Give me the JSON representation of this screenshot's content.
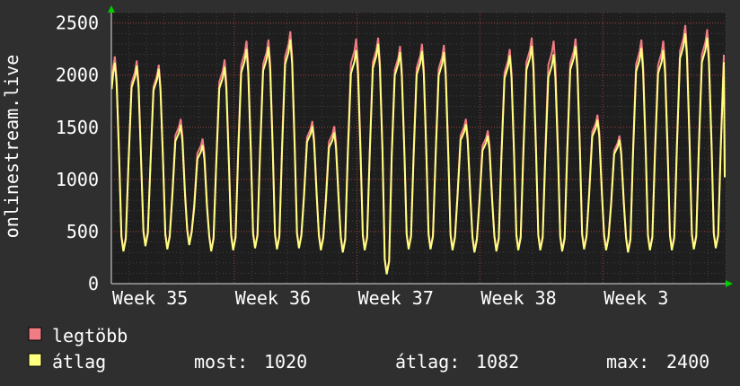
{
  "chart_data": {
    "type": "line",
    "ylabel": "onlinestream.live",
    "ylim": [
      0,
      2600
    ],
    "yticks": [
      0,
      500,
      1000,
      1500,
      2000,
      2500
    ],
    "xlim": [
      0,
      35
    ],
    "xticks": [
      {
        "label": "Week 35",
        "at": 0
      },
      {
        "label": "Week 36",
        "at": 7
      },
      {
        "label": "Week 37",
        "at": 14
      },
      {
        "label": "Week 38",
        "at": 21
      },
      {
        "label": "Week 3",
        "at": 28
      }
    ],
    "grid": true,
    "legend_position": "bottom-left",
    "daily_peaks": [
      {
        "max": 2180,
        "avg": 2120
      },
      {
        "max": 2140,
        "avg": 2090
      },
      {
        "max": 2100,
        "avg": 2060
      },
      {
        "max": 1580,
        "avg": 1520
      },
      {
        "max": 1390,
        "avg": 1330
      },
      {
        "max": 2150,
        "avg": 2080
      },
      {
        "max": 2330,
        "avg": 2250
      },
      {
        "max": 2340,
        "avg": 2270
      },
      {
        "max": 2420,
        "avg": 2340
      },
      {
        "max": 1560,
        "avg": 1510
      },
      {
        "max": 1510,
        "avg": 1450
      },
      {
        "max": 2350,
        "avg": 2240
      },
      {
        "max": 2360,
        "avg": 2300
      },
      {
        "max": 2280,
        "avg": 2220
      },
      {
        "max": 2300,
        "avg": 2230
      },
      {
        "max": 2290,
        "avg": 2220
      },
      {
        "max": 1580,
        "avg": 1530
      },
      {
        "max": 1470,
        "avg": 1420
      },
      {
        "max": 2250,
        "avg": 2190
      },
      {
        "max": 2360,
        "avg": 2280
      },
      {
        "max": 2330,
        "avg": 2200
      },
      {
        "max": 2350,
        "avg": 2280
      },
      {
        "max": 1620,
        "avg": 1570
      },
      {
        "max": 1420,
        "avg": 1380
      },
      {
        "max": 2340,
        "avg": 2260
      },
      {
        "max": 2330,
        "avg": 2240
      },
      {
        "max": 2480,
        "avg": 2400
      },
      {
        "max": 2440,
        "avg": 2360
      }
    ],
    "daily_troughs": [
      310,
      360,
      330,
      370,
      310,
      320,
      340,
      330,
      340,
      320,
      300,
      320,
      90,
      330,
      330,
      320,
      300,
      310,
      320,
      320,
      310,
      330,
      320,
      300,
      320,
      320,
      330,
      340
    ],
    "final_value": 1020,
    "series": [
      {
        "name": "legtöbb",
        "color": "#f07c84"
      },
      {
        "name": "átlag",
        "color": "#ffff80"
      }
    ],
    "axis_color": "#00cc00",
    "grid_color": "#ff4f4f",
    "plot_background": "#1e1e1e"
  },
  "legend": {
    "max_label": "legtöbb",
    "avg_label": "átlag"
  },
  "stats": {
    "now_label": "most:",
    "now_value": "1020",
    "avg_label": "átlag:",
    "avg_value": "1082",
    "max_label": "max:",
    "max_value": "2400"
  }
}
